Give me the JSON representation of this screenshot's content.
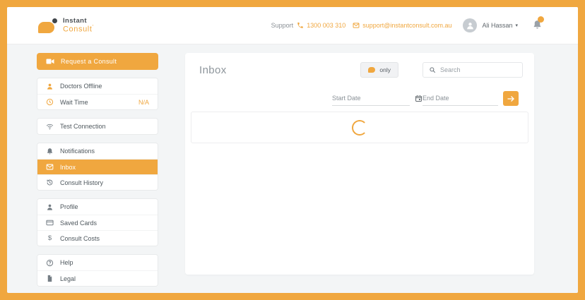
{
  "colors": {
    "accent": "#F0A73F",
    "page_background": "#f3f5f6"
  },
  "brand": {
    "line1": "Instant",
    "line2": "Consult",
    "tm": "’"
  },
  "header": {
    "support_label": "Support",
    "phone": "1300 003 310",
    "email": "support@instantconsult.com.au",
    "user_name": "Ali Hassan",
    "caret": "▾"
  },
  "sidebar": {
    "request_button": {
      "label": "Request a Consult",
      "icon": "video-camera-icon"
    },
    "status_card": [
      {
        "label": "Doctors Offline",
        "icon": "doctor-icon"
      },
      {
        "label": "Wait Time",
        "icon": "clock-icon",
        "value": "N/A"
      }
    ],
    "connection_card": [
      {
        "label": "Test Connection",
        "icon": "wifi-icon"
      }
    ],
    "nav_card": [
      {
        "label": "Notifications",
        "icon": "bell-icon",
        "active": false
      },
      {
        "label": "Inbox",
        "icon": "envelope-icon",
        "active": true
      },
      {
        "label": "Consult History",
        "icon": "history-icon",
        "active": false
      }
    ],
    "account_card": [
      {
        "label": "Profile",
        "icon": "person-icon"
      },
      {
        "label": "Saved Cards",
        "icon": "credit-card-icon"
      },
      {
        "label": "Consult Costs",
        "icon": "dollar-icon",
        "icon_char": "$"
      }
    ],
    "info_card": [
      {
        "label": "Help",
        "icon": "help-icon"
      },
      {
        "label": "Legal",
        "icon": "document-icon"
      }
    ]
  },
  "main": {
    "title": "Inbox",
    "filter_button": {
      "label": "only",
      "icon": "instant-consult-logo-icon"
    },
    "search": {
      "placeholder": "Search"
    },
    "date_filter": {
      "start_placeholder": "Start Date",
      "end_placeholder": "End Date"
    },
    "loading": true
  }
}
